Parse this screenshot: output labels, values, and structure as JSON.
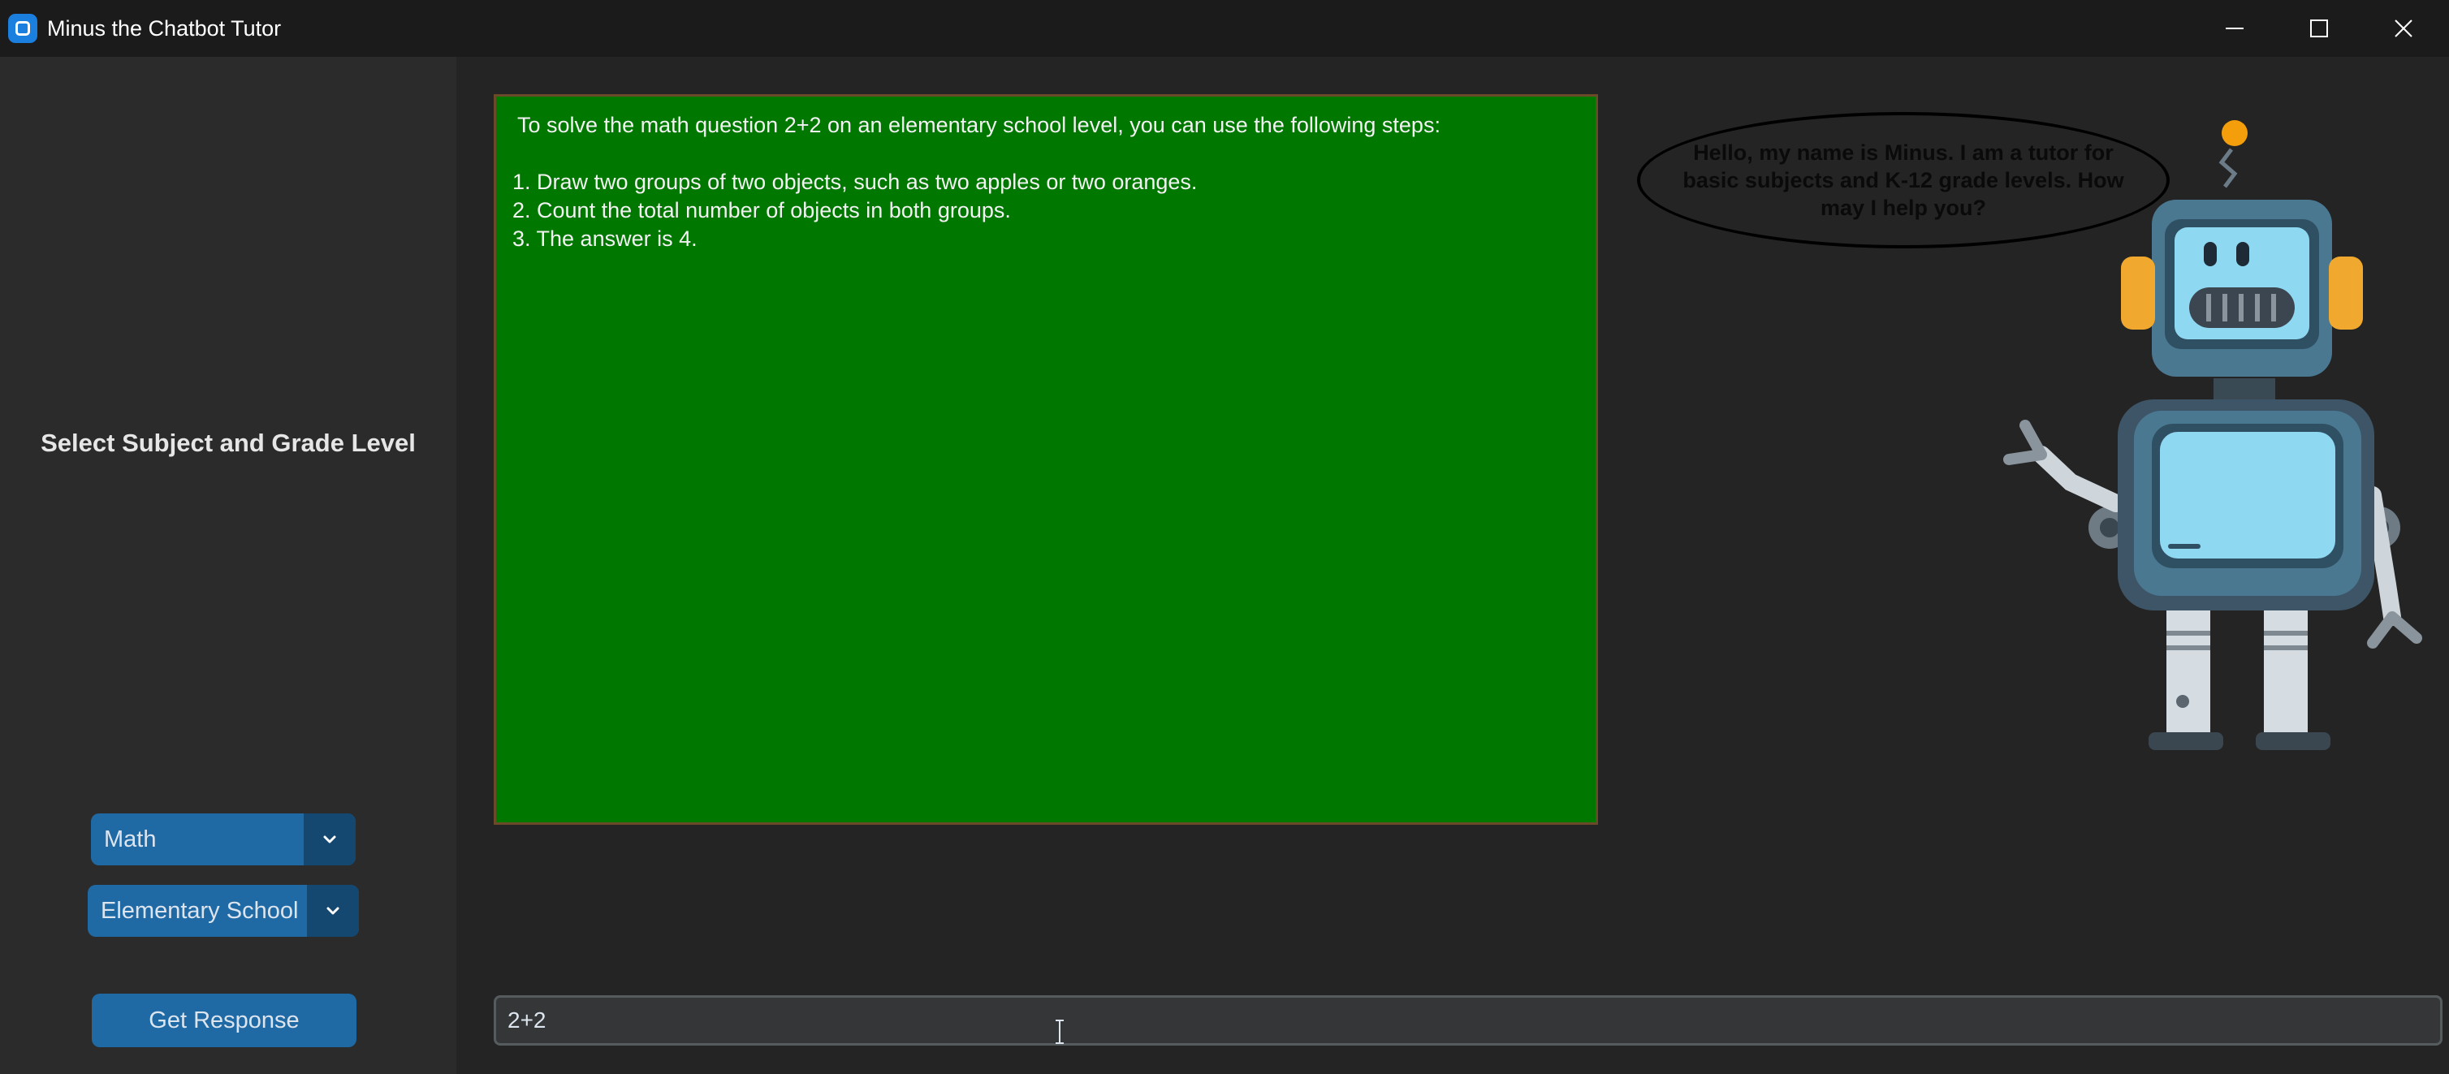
{
  "window": {
    "title": "Minus the Chatbot Tutor",
    "controls": {
      "minimize": "minimize-icon",
      "maximize": "maximize-icon",
      "close": "close-icon"
    }
  },
  "sidebar": {
    "heading": "Select Subject and Grade Level",
    "subject_dropdown": {
      "selected": "Math"
    },
    "grade_dropdown": {
      "selected": "Elementary School"
    },
    "get_response_label": "Get Response"
  },
  "response": {
    "lines": [
      "To solve the math question 2+2 on an elementary school level, you can use the following steps:",
      "1. Draw two groups of two objects, such as two apples or two oranges.",
      "2. Count the total number of objects in both groups.",
      "3. The answer is 4."
    ]
  },
  "tutor": {
    "greeting": "Hello, my name is Minus. I am a tutor for basic subjects and K-12 grade levels. How may I help you?"
  },
  "input": {
    "value": "2+2"
  },
  "colors": {
    "accent": "#1f6aa5",
    "accent_dark": "#144870",
    "board": "#007800",
    "background": "#242424",
    "sidebar": "#2b2b2b"
  }
}
